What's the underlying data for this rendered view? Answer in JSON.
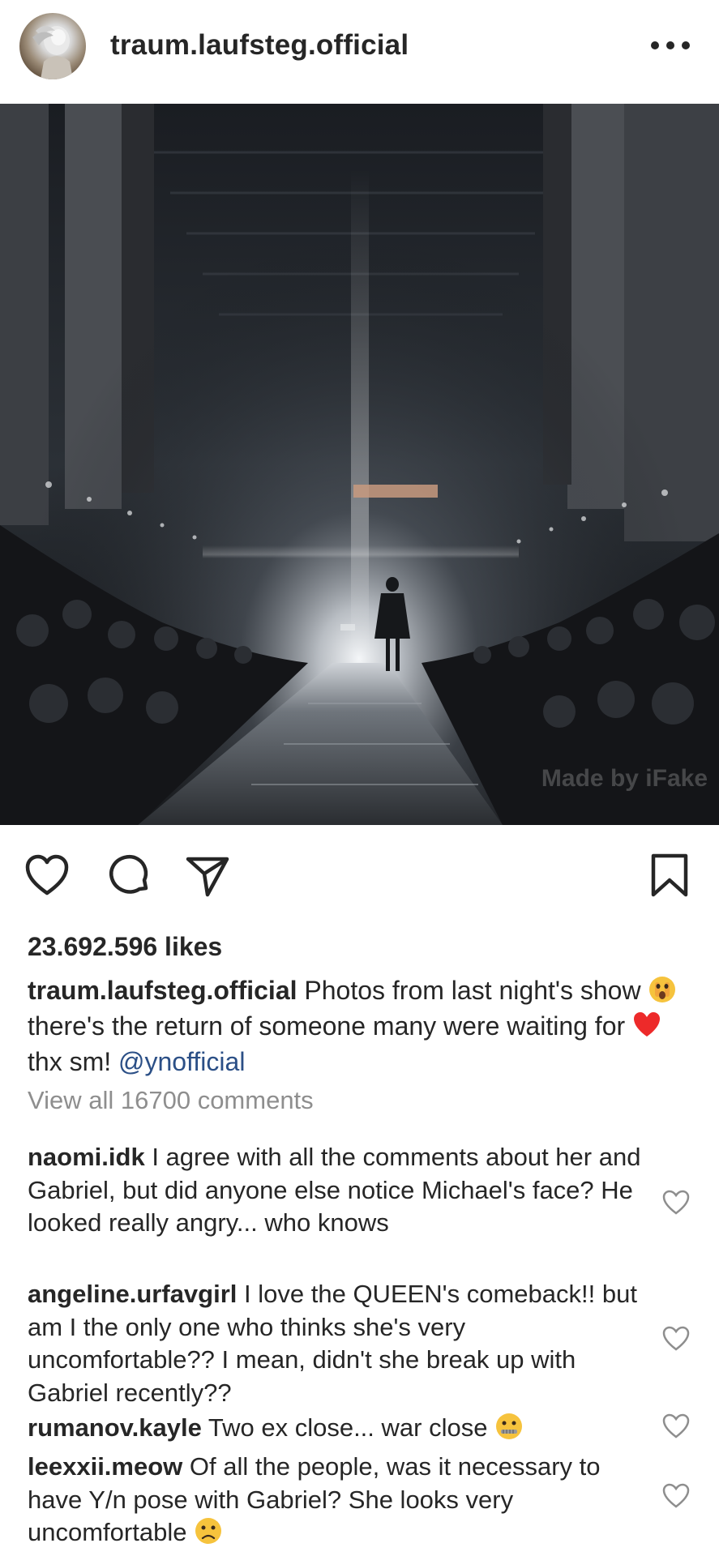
{
  "post": {
    "username": "traum.laufsteg.official",
    "more_icon": "more-options-icon",
    "watermark": "Made by iFake"
  },
  "actions": {
    "icons": [
      "heart-icon",
      "comment-icon",
      "share-icon",
      "bookmark-icon"
    ]
  },
  "likes": "23.692.596 likes",
  "caption": {
    "user": "traum.laufsteg.official",
    "text_part1": "Photos from last night's show",
    "emoji1": "shocked-face-emoji",
    "text_part2": "there's the return of someone many were waiting for",
    "emoji2": "red-heart-emoji",
    "text_part3": "thx sm!",
    "mention": "@ynofficial"
  },
  "view_all": "View all 16700 comments",
  "comments": [
    {
      "user": "naomi.idk",
      "text": "I agree with all the comments about her and Gabriel, but did anyone else notice Michael's face? He looked really angry... who knows"
    },
    {
      "user": "angeline.urfavgirl",
      "text": "I love the QUEEN's comeback!! but am I the only one who thinks she's very uncomfortable?? I mean, didn't she break up with Gabriel recently??"
    },
    {
      "user": "rumanov.kayle",
      "text": "Two ex close... war close",
      "emoji": "zipper-mouth-emoji"
    },
    {
      "user": "leexxii.meow",
      "text": "Of all the people, was it necessary to have Y/n pose with Gabriel? She looks very uncomfortable",
      "emoji": "frowning-face-emoji"
    }
  ],
  "colors": {
    "text": "#262626",
    "muted": "#8e8e8e",
    "mention": "#2b4f86",
    "heart_red": "#ed2a2a"
  }
}
